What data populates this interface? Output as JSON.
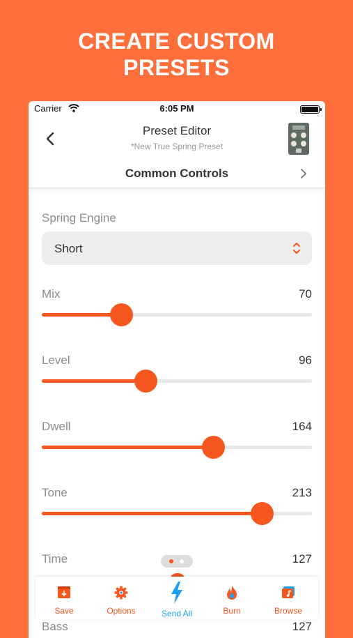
{
  "promo": {
    "line1": "CREATE CUSTOM",
    "line2": "PRESETS"
  },
  "status_bar": {
    "carrier": "Carrier",
    "time": "6:05 PM"
  },
  "nav": {
    "title": "Preset Editor",
    "subtitle": "*New True Spring Preset",
    "back_icon": "chevron-left-icon"
  },
  "section": {
    "label": "Common Controls",
    "icon": "chevron-right-icon"
  },
  "engine": {
    "label": "Spring Engine",
    "selected": "Short"
  },
  "sliders": [
    {
      "name": "Mix",
      "value": "70",
      "fraction": 0.295
    },
    {
      "name": "Level",
      "value": "96",
      "fraction": 0.385
    },
    {
      "name": "Dwell",
      "value": "164",
      "fraction": 0.635
    },
    {
      "name": "Tone",
      "value": "213",
      "fraction": 0.815
    },
    {
      "name": "Time",
      "value": "127"
    }
  ],
  "bass": {
    "name": "Bass",
    "value": "127"
  },
  "tabs": [
    {
      "label": "Save",
      "icon": "save-icon"
    },
    {
      "label": "Options",
      "icon": "gear-icon"
    },
    {
      "label": "Send All",
      "icon": "lightning-icon"
    },
    {
      "label": "Burn",
      "icon": "flame-icon"
    },
    {
      "label": "Browse",
      "icon": "music-folder-icon"
    }
  ],
  "colors": {
    "background": "#FF6F3C",
    "accent": "#F5571E",
    "active_tab": "#1EA0F0"
  }
}
